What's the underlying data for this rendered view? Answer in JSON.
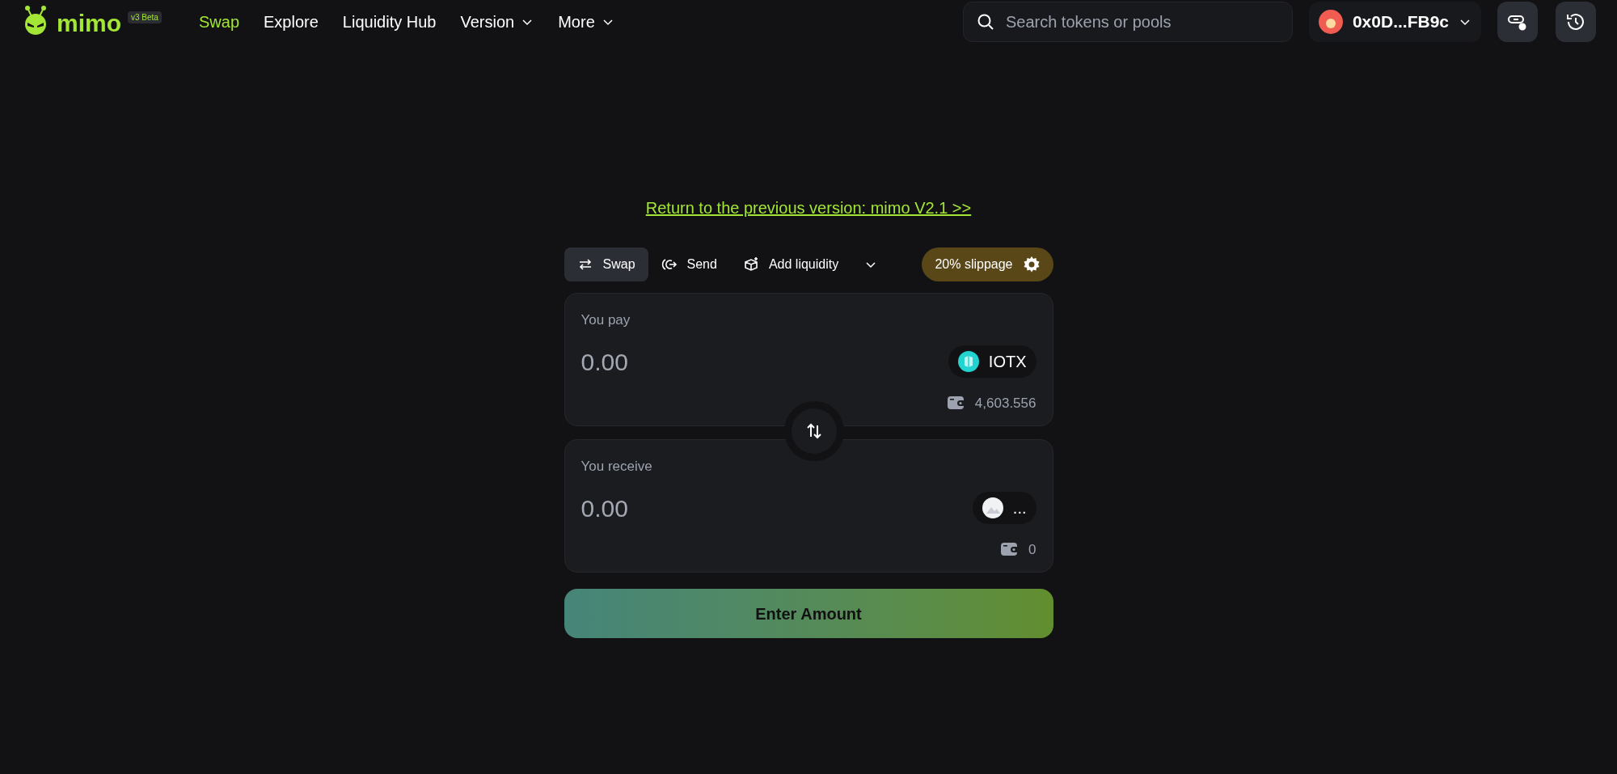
{
  "header": {
    "logo": "mimo",
    "badge": "v3 Beta",
    "nav": [
      {
        "label": "Swap",
        "selected": true,
        "dropdown": false
      },
      {
        "label": "Explore",
        "selected": false,
        "dropdown": false
      },
      {
        "label": "Liquidity Hub",
        "selected": false,
        "dropdown": false
      },
      {
        "label": "Version",
        "selected": false,
        "dropdown": true
      },
      {
        "label": "More",
        "selected": false,
        "dropdown": true
      }
    ],
    "search": {
      "placeholder": "Search tokens or pools"
    },
    "wallet": {
      "address": "0x0D...FB9c"
    }
  },
  "return_link": "Return to the previous version: mimo V2.1 >>",
  "modes": [
    {
      "kind": "swap",
      "label": "Swap",
      "selected": true
    },
    {
      "kind": "send",
      "label": "Send",
      "selected": false
    },
    {
      "kind": "liquidity",
      "label": "Add liquidity",
      "selected": false
    }
  ],
  "slippage": "20% slippage",
  "panels": [
    {
      "label": "You pay",
      "placeholder": "0.00",
      "token": "IOTX",
      "kind": "iotx",
      "balance": "4,603.556"
    },
    {
      "label": "You receive",
      "placeholder": "0.00",
      "token": "...",
      "kind": "unknown",
      "balance": "0"
    }
  ],
  "submit": "Enter Amount"
}
